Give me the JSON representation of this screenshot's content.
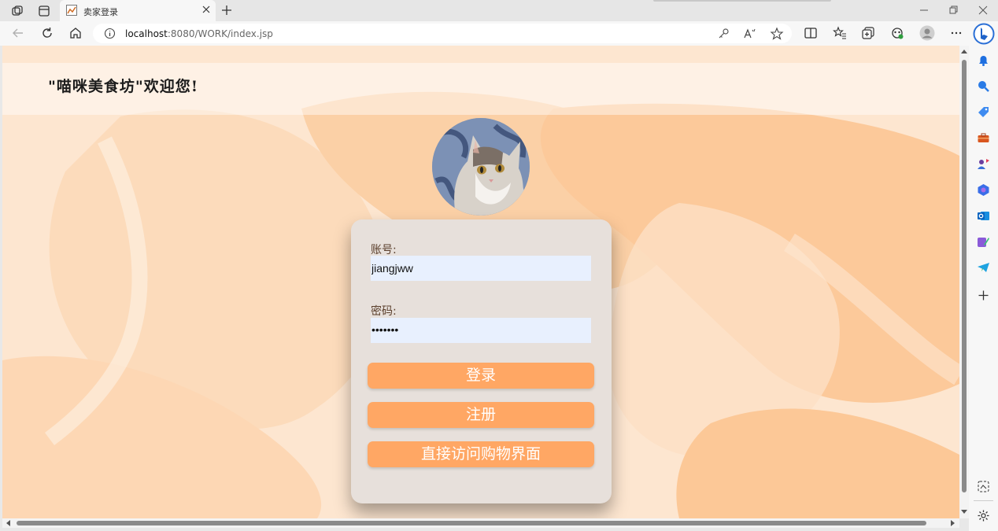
{
  "browser": {
    "tab_title": "卖家登录",
    "url_host": "localhost",
    "url_path": ":8080/WORK/index.jsp"
  },
  "page": {
    "welcome_text": "\"喵咪美食坊\"欢迎您!",
    "account_label": "账号:",
    "account_value": "jiangjww",
    "password_label": "密码:",
    "password_value": "•••••••",
    "login_button": "登录",
    "register_button": "注册",
    "direct_button": "直接访问购物界面"
  },
  "colors": {
    "button": "#ffa764",
    "card": "#e7e0db",
    "input_bg": "#e8f0fe",
    "page_bg": "#fde7d2"
  },
  "icons": {
    "tabbar": [
      "workspaces-icon",
      "tab-actions-icon"
    ],
    "toolbar": [
      "back-icon",
      "refresh-icon",
      "home-icon"
    ],
    "address_right": [
      "key-icon",
      "read-aloud-icon",
      "favorite-star-icon"
    ],
    "toolbar_right": [
      "split-screen-icon",
      "favorites-icon",
      "collections-icon",
      "extensions-icon",
      "profile-icon",
      "more-icon"
    ],
    "sidebar": [
      "bell-icon",
      "search-icon",
      "tag-icon",
      "toolbox-icon",
      "games-icon",
      "microsoft365-icon",
      "outlook-icon",
      "designer-icon",
      "telegram-icon",
      "add-icon",
      "screenshot-icon",
      "settings-icon"
    ]
  }
}
